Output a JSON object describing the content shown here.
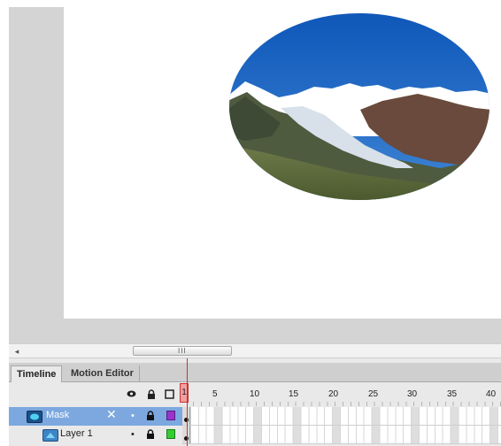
{
  "scrollbar": {
    "left_arrow": "◂",
    "thumb_grip": "III"
  },
  "timeline": {
    "tabs": [
      {
        "label": "Timeline",
        "active": true
      },
      {
        "label": "Motion Editor",
        "active": false
      }
    ],
    "header_icons": [
      "eye-icon",
      "lock-icon",
      "outline-icon"
    ],
    "frame_numbers": [
      "1",
      "5",
      "10",
      "15",
      "20",
      "25",
      "30",
      "35",
      "40"
    ],
    "current_frame": "1",
    "layers": [
      {
        "name": "Mask",
        "type": "mask-layer-icon",
        "selected": true,
        "visible_mark": "•",
        "locked": true,
        "color": "#9933cc",
        "editing_icon": "pencil-crossed-icon"
      },
      {
        "name": "Layer 1",
        "type": "masked-layer-icon",
        "selected": false,
        "visible_mark": "•",
        "locked": true,
        "color": "#33cc33"
      }
    ]
  },
  "colors": {
    "selected_row": "#7ca8df",
    "playhead": "#cc3333",
    "stage_border": "#d4d4d4"
  }
}
